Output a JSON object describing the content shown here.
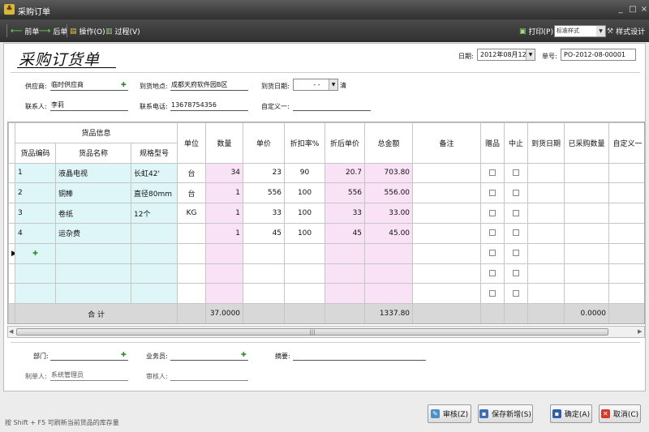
{
  "window": {
    "title": "采购订单",
    "minimize": "_",
    "maximize": "□",
    "close": "×"
  },
  "toolbar": {
    "prev": "前单",
    "next": "后单",
    "operate": "操作(O)",
    "process": "过程(V)",
    "print": "打印(P)",
    "style_select": "标准样式",
    "style_design": "样式设计"
  },
  "form": {
    "title": "采购订货单",
    "date_label": "日期:",
    "date_value": "2012年08月12日",
    "order_no_label": "单号:",
    "order_no_value": "PO-2012-08-00001",
    "supplier_label": "供应商:",
    "supplier_value": "临时供应商",
    "delivery_place_label": "到货地点:",
    "delivery_place_value": "成都天府软件园B区",
    "delivery_date_label": "到货日期:",
    "delivery_date_value": "- -",
    "clear_label": "清",
    "contact_label": "联系人:",
    "contact_value": "李莉",
    "phone_label": "联系电话:",
    "phone_value": "13678754356",
    "custom1_label": "自定义一:",
    "custom1_value": ""
  },
  "grid": {
    "group_header": "货品信息",
    "headers": [
      "货品编码",
      "货品名称",
      "规格型号",
      "单位",
      "数量",
      "单价",
      "折扣率%",
      "折后单价",
      "总金额",
      "备注",
      "赠品",
      "中止",
      "到货日期",
      "已采购数量",
      "自定义一"
    ],
    "rows": [
      {
        "code": "1",
        "name": "液晶电视",
        "spec": "长虹42'",
        "unit": "台",
        "qty": "34",
        "price": "23",
        "discount": "90",
        "net_price": "20.7",
        "amount": "703.80"
      },
      {
        "code": "2",
        "name": "铜棒",
        "spec": "直径80mm",
        "unit": "台",
        "qty": "1",
        "price": "556",
        "discount": "100",
        "net_price": "556",
        "amount": "556.00"
      },
      {
        "code": "3",
        "name": "卷纸",
        "spec": "12个",
        "unit": "KG",
        "qty": "1",
        "price": "33",
        "discount": "100",
        "net_price": "33",
        "amount": "33.00"
      },
      {
        "code": "4",
        "name": "运杂费",
        "spec": "",
        "unit": "",
        "qty": "1",
        "price": "45",
        "discount": "100",
        "net_price": "45",
        "amount": "45.00"
      }
    ],
    "total_label": "合 计",
    "total_qty": "37.0000",
    "total_amount": "1337.80",
    "total_purchased": "0.0000"
  },
  "footer": {
    "dept_label": "部门:",
    "dept_value": "",
    "salesman_label": "业务员:",
    "salesman_value": "",
    "summary_label": "摘要:",
    "summary_value": "",
    "maker_label": "制单人:",
    "maker_value": "系统管理员",
    "reviewer_label": "审核人:",
    "reviewer_value": ""
  },
  "buttons": {
    "audit": "审核(Z)",
    "save_new": "保存新增(S)",
    "ok": "确定(A)",
    "cancel": "取消(C)"
  },
  "status": "按 Shift + F5 可刷新当前货品的库存量",
  "colors": {
    "info_col": "#dff6f8",
    "value_col": "#f9e2f6",
    "titlebar": "#3a3a3a"
  }
}
